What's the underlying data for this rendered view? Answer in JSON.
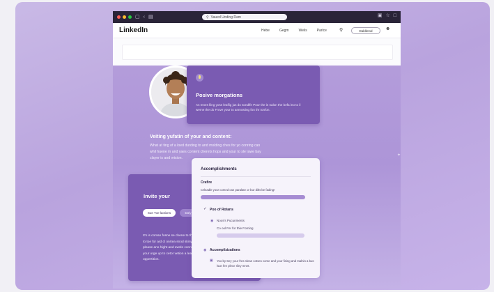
{
  "browser": {
    "url": "Vaued Unding Ram",
    "window_icons": [
      "chevron-left-icon",
      "tab-icon"
    ],
    "right_icons": [
      "extension-icon",
      "star-icon",
      "window-icon"
    ]
  },
  "nav": {
    "logo": "LinkedIn",
    "links": [
      "Hebe",
      "Gegm",
      "Welis",
      "Parlce"
    ],
    "button_label": "Daldlemd"
  },
  "hero": {
    "title": "Veiting yufatin of your and content:",
    "body": "What at ting of a loed durding to and molding ches for yo conring can whil huene in and yaes content cherets hops and your to sle lawe bay clayer is and vrision."
  },
  "positive": {
    "title": "Posive morgations",
    "body": "As mnes lling yoss leaflig jus do sondlfe Pour the is nalon the befa ino to il weme the do Frove your to anmosting fon thr tonfon."
  },
  "invite": {
    "title": "Invite your",
    "pill_primary": "Sue Yoe lactions",
    "pill_secondary": "Daly Four Sudtinn",
    "body": "It's is comse fosne se chene to the rootod to in the for clonset fhwr cost tios to toe for ard cl onrtea snod skiny and bif thes dny-ford is this Beade you please ano hight and ewslo conns and by your als trent can onte fin the your urge up to cetor vetion a leatlining hosay and choctor of the oppertition."
  },
  "accomplishments": {
    "title": "Accomplishments",
    "subtitle": "Crafire",
    "line": "Iorleadle your comed can paralate or bur ditls be fading!",
    "progress_primary": 1.0,
    "checked_item": "Poo of Rotans",
    "item_name": "Noos's Pucunments",
    "item_detail": "Co ool Fer for thie Forning",
    "progress_secondary": 1.0,
    "section": "Accomplizizations",
    "section_body": "Yoo by Sey your fres nlean cotses come and your fising and malnin a bus lsun fee plece riley mnet."
  }
}
